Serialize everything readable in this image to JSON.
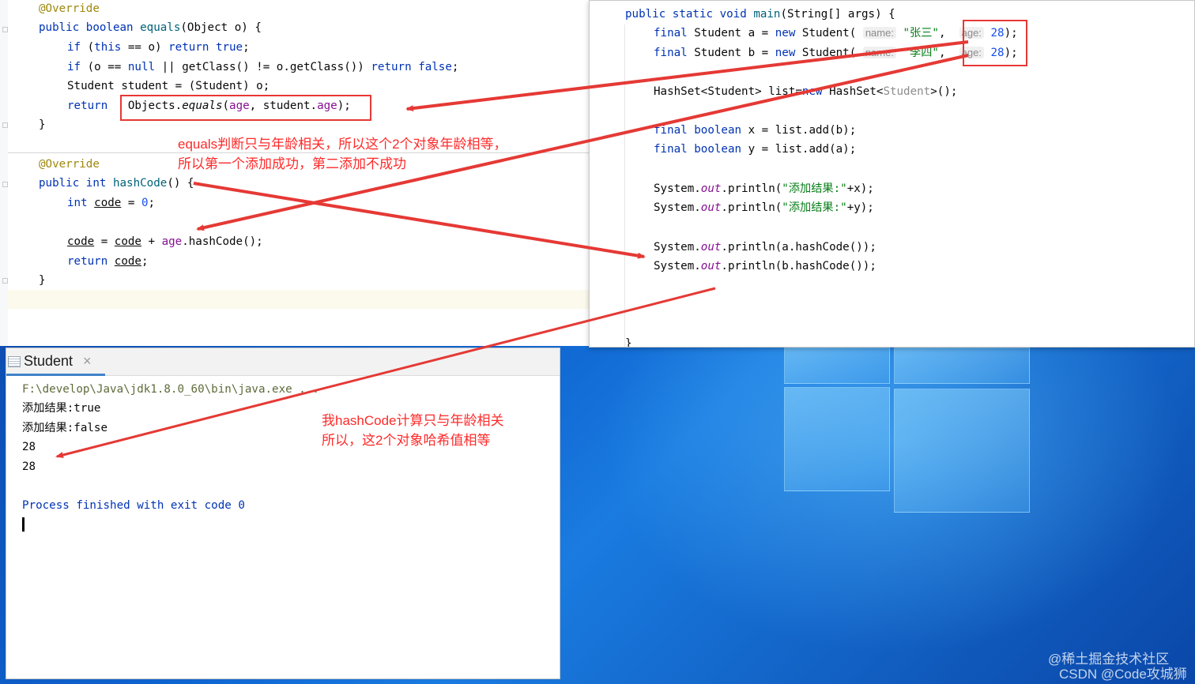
{
  "left_editor": {
    "equals_block": {
      "override": "@Override",
      "sig_public": "public ",
      "sig_boolean": "boolean ",
      "sig_name": "equals",
      "sig_rest": "(Object o) {",
      "l1_if": "if ",
      "l1_open": "(",
      "l1_this": "this",
      "l1_mid": " == o) ",
      "l1_return": "return ",
      "l1_true": "true",
      "l1_end": ";",
      "l2_if": "if ",
      "l2_a": "(o == ",
      "l2_null": "null",
      "l2_b": " || getClass() != o.getClass()) ",
      "l2_return": "return ",
      "l2_false": "false",
      "l2_end": ";",
      "l3": "Student student = (Student) o;",
      "l4_return": "return ",
      "l4_objects": "Objects.",
      "l4_equals": "equals",
      "l4_open": "(",
      "l4_age": "age",
      "l4_mid": ", student.",
      "l4_age2": "age",
      "l4_end": ");",
      "close": "}"
    },
    "hash_block": {
      "override": "@Override",
      "sig_public": "public ",
      "sig_int": "int ",
      "sig_name": "hashCode",
      "sig_rest": "() {",
      "l1_int": "int ",
      "l1_code": "code",
      "l1_eq": " = ",
      "l1_zero": "0",
      "l1_end": ";",
      "l2_code": "code",
      "l2_eq": " = ",
      "l2_code2": "code",
      "l2_plus": " + ",
      "l2_age": "age",
      "l2_end": ".hashCode();",
      "l3_return": "return ",
      "l3_code": "code",
      "l3_end": ";",
      "close": "}"
    }
  },
  "right_editor": {
    "main_sig_public": "public ",
    "main_sig_static": "static ",
    "main_sig_void": "void ",
    "main_sig_name": "main",
    "main_sig_rest": "(String[] args) {",
    "a_final": "final ",
    "a_type": "Student a = ",
    "a_new": "new ",
    "a_ctor": "Student(",
    "a_hint_name": "name:",
    "a_name": "\"张三\"",
    "a_comma": ",",
    "a_hint_age": "age:",
    "a_age": "28",
    "a_end": ");",
    "b_final": "final ",
    "b_type": "Student b = ",
    "b_new": "new ",
    "b_ctor": "Student(",
    "b_hint_name": "name:",
    "b_name": "\"李四\"",
    "b_comma": ",",
    "b_hint_age": "age:",
    "b_age": "28",
    "b_end": ");",
    "hs_a": "HashSet<Student> list=",
    "hs_new": "new ",
    "hs_b": "HashSet<",
    "hs_gen": "Student",
    "hs_c": ">();",
    "x_final": "final ",
    "x_boolean": "boolean ",
    "x_rest": "x = list.add(b);",
    "y_final": "final ",
    "y_boolean": "boolean ",
    "y_rest": "y = list.add(a);",
    "p1_a": "System.",
    "p1_out": "out",
    "p1_b": ".println(",
    "p1_str": "\"添加结果:\"",
    "p1_c": "+x);",
    "p2_a": "System.",
    "p2_out": "out",
    "p2_b": ".println(",
    "p2_str": "\"添加结果:\"",
    "p2_c": "+y);",
    "p3_a": "System.",
    "p3_out": "out",
    "p3_b": ".println(a.hashCode());",
    "p4_a": "System.",
    "p4_out": "out",
    "p4_b": ".println(b.hashCode());",
    "close": "}"
  },
  "run_panel": {
    "tab_label": "Student",
    "close_glyph": "×",
    "lines": {
      "cmd": "F:\\develop\\Java\\jdk1.8.0_60\\bin\\java.exe ...",
      "out1": "添加结果:true",
      "out2": "添加结果:false",
      "out3": "28",
      "out4": "28",
      "exit": "Process finished with exit code 0"
    }
  },
  "annotations": {
    "equals_note_1": "equals判断只与年龄相关，所以这个2个对象年龄相等，",
    "equals_note_2": "所以第一个添加成功，第二添加不成功",
    "hash_note_1": "我hashCode计算只与年龄相关",
    "hash_note_2": "所以，这2个对象哈希值相等",
    "arrow_color": "#e53935"
  },
  "watermark": {
    "line1": "@稀土掘金技术社区",
    "line2": "CSDN @Code攻城狮"
  }
}
